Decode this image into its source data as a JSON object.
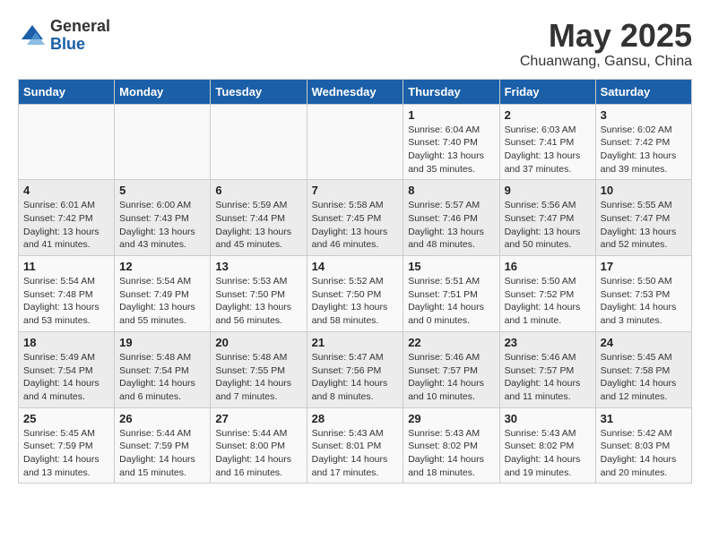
{
  "logo": {
    "general": "General",
    "blue": "Blue"
  },
  "title": "May 2025",
  "subtitle": "Chuanwang, Gansu, China",
  "headers": [
    "Sunday",
    "Monday",
    "Tuesday",
    "Wednesday",
    "Thursday",
    "Friday",
    "Saturday"
  ],
  "weeks": [
    [
      {
        "day": "",
        "info": ""
      },
      {
        "day": "",
        "info": ""
      },
      {
        "day": "",
        "info": ""
      },
      {
        "day": "",
        "info": ""
      },
      {
        "day": "1",
        "info": "Sunrise: 6:04 AM\nSunset: 7:40 PM\nDaylight: 13 hours\nand 35 minutes."
      },
      {
        "day": "2",
        "info": "Sunrise: 6:03 AM\nSunset: 7:41 PM\nDaylight: 13 hours\nand 37 minutes."
      },
      {
        "day": "3",
        "info": "Sunrise: 6:02 AM\nSunset: 7:42 PM\nDaylight: 13 hours\nand 39 minutes."
      }
    ],
    [
      {
        "day": "4",
        "info": "Sunrise: 6:01 AM\nSunset: 7:42 PM\nDaylight: 13 hours\nand 41 minutes."
      },
      {
        "day": "5",
        "info": "Sunrise: 6:00 AM\nSunset: 7:43 PM\nDaylight: 13 hours\nand 43 minutes."
      },
      {
        "day": "6",
        "info": "Sunrise: 5:59 AM\nSunset: 7:44 PM\nDaylight: 13 hours\nand 45 minutes."
      },
      {
        "day": "7",
        "info": "Sunrise: 5:58 AM\nSunset: 7:45 PM\nDaylight: 13 hours\nand 46 minutes."
      },
      {
        "day": "8",
        "info": "Sunrise: 5:57 AM\nSunset: 7:46 PM\nDaylight: 13 hours\nand 48 minutes."
      },
      {
        "day": "9",
        "info": "Sunrise: 5:56 AM\nSunset: 7:47 PM\nDaylight: 13 hours\nand 50 minutes."
      },
      {
        "day": "10",
        "info": "Sunrise: 5:55 AM\nSunset: 7:47 PM\nDaylight: 13 hours\nand 52 minutes."
      }
    ],
    [
      {
        "day": "11",
        "info": "Sunrise: 5:54 AM\nSunset: 7:48 PM\nDaylight: 13 hours\nand 53 minutes."
      },
      {
        "day": "12",
        "info": "Sunrise: 5:54 AM\nSunset: 7:49 PM\nDaylight: 13 hours\nand 55 minutes."
      },
      {
        "day": "13",
        "info": "Sunrise: 5:53 AM\nSunset: 7:50 PM\nDaylight: 13 hours\nand 56 minutes."
      },
      {
        "day": "14",
        "info": "Sunrise: 5:52 AM\nSunset: 7:50 PM\nDaylight: 13 hours\nand 58 minutes."
      },
      {
        "day": "15",
        "info": "Sunrise: 5:51 AM\nSunset: 7:51 PM\nDaylight: 14 hours\nand 0 minutes."
      },
      {
        "day": "16",
        "info": "Sunrise: 5:50 AM\nSunset: 7:52 PM\nDaylight: 14 hours\nand 1 minute."
      },
      {
        "day": "17",
        "info": "Sunrise: 5:50 AM\nSunset: 7:53 PM\nDaylight: 14 hours\nand 3 minutes."
      }
    ],
    [
      {
        "day": "18",
        "info": "Sunrise: 5:49 AM\nSunset: 7:54 PM\nDaylight: 14 hours\nand 4 minutes."
      },
      {
        "day": "19",
        "info": "Sunrise: 5:48 AM\nSunset: 7:54 PM\nDaylight: 14 hours\nand 6 minutes."
      },
      {
        "day": "20",
        "info": "Sunrise: 5:48 AM\nSunset: 7:55 PM\nDaylight: 14 hours\nand 7 minutes."
      },
      {
        "day": "21",
        "info": "Sunrise: 5:47 AM\nSunset: 7:56 PM\nDaylight: 14 hours\nand 8 minutes."
      },
      {
        "day": "22",
        "info": "Sunrise: 5:46 AM\nSunset: 7:57 PM\nDaylight: 14 hours\nand 10 minutes."
      },
      {
        "day": "23",
        "info": "Sunrise: 5:46 AM\nSunset: 7:57 PM\nDaylight: 14 hours\nand 11 minutes."
      },
      {
        "day": "24",
        "info": "Sunrise: 5:45 AM\nSunset: 7:58 PM\nDaylight: 14 hours\nand 12 minutes."
      }
    ],
    [
      {
        "day": "25",
        "info": "Sunrise: 5:45 AM\nSunset: 7:59 PM\nDaylight: 14 hours\nand 13 minutes."
      },
      {
        "day": "26",
        "info": "Sunrise: 5:44 AM\nSunset: 7:59 PM\nDaylight: 14 hours\nand 15 minutes."
      },
      {
        "day": "27",
        "info": "Sunrise: 5:44 AM\nSunset: 8:00 PM\nDaylight: 14 hours\nand 16 minutes."
      },
      {
        "day": "28",
        "info": "Sunrise: 5:43 AM\nSunset: 8:01 PM\nDaylight: 14 hours\nand 17 minutes."
      },
      {
        "day": "29",
        "info": "Sunrise: 5:43 AM\nSunset: 8:02 PM\nDaylight: 14 hours\nand 18 minutes."
      },
      {
        "day": "30",
        "info": "Sunrise: 5:43 AM\nSunset: 8:02 PM\nDaylight: 14 hours\nand 19 minutes."
      },
      {
        "day": "31",
        "info": "Sunrise: 5:42 AM\nSunset: 8:03 PM\nDaylight: 14 hours\nand 20 minutes."
      }
    ]
  ]
}
